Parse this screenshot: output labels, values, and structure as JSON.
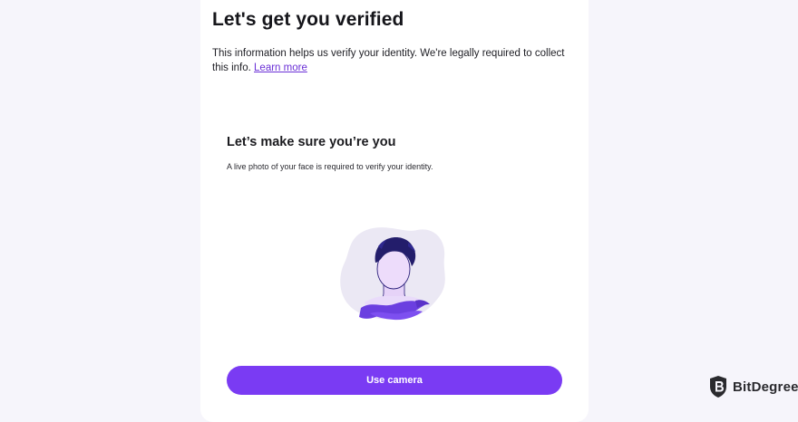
{
  "header": {
    "title": "Let's get you verified",
    "intro_text": "This information helps us verify your identity. We're legally required to collect this info.",
    "learn_more": "Learn more"
  },
  "selfie": {
    "title": "Let’s make sure you’re you",
    "description": "A live photo of your face is required to verify your identity.",
    "illustration_icon": "face-portrait-icon"
  },
  "actions": {
    "use_camera": "Use camera"
  },
  "watermark": {
    "text": "BitDegree",
    "icon": "bitdegree-shield-icon"
  },
  "colors": {
    "accent": "#7a3bf3",
    "link": "#6a2fd6",
    "page_background": "#f6f5fb",
    "card_background": "#ffffff"
  }
}
